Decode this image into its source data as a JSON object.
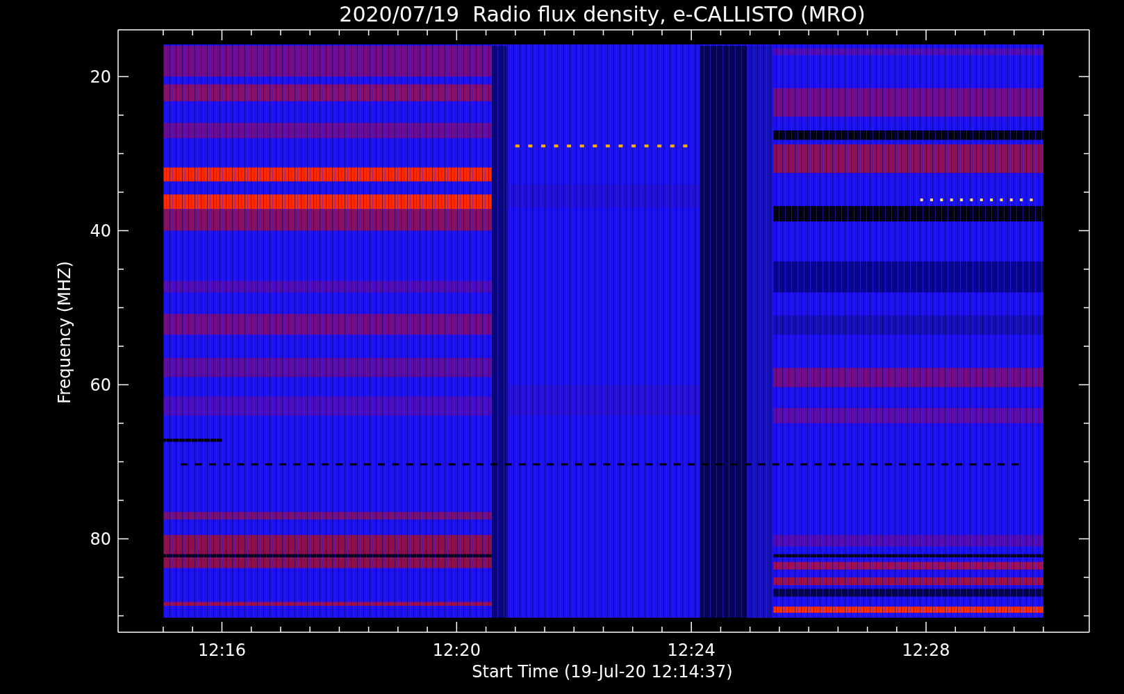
{
  "plot": {
    "title": "2020/07/19  Radio flux density, e-CALLISTO (MRO)",
    "xlabel": "Start Time (19-Jul-20 12:14:37)",
    "ylabel": "Frequency (MHZ)",
    "xticks": [
      "12:16",
      "12:20",
      "12:24",
      "12:28"
    ],
    "yticks": [
      "20",
      "40",
      "60",
      "80"
    ]
  }
}
